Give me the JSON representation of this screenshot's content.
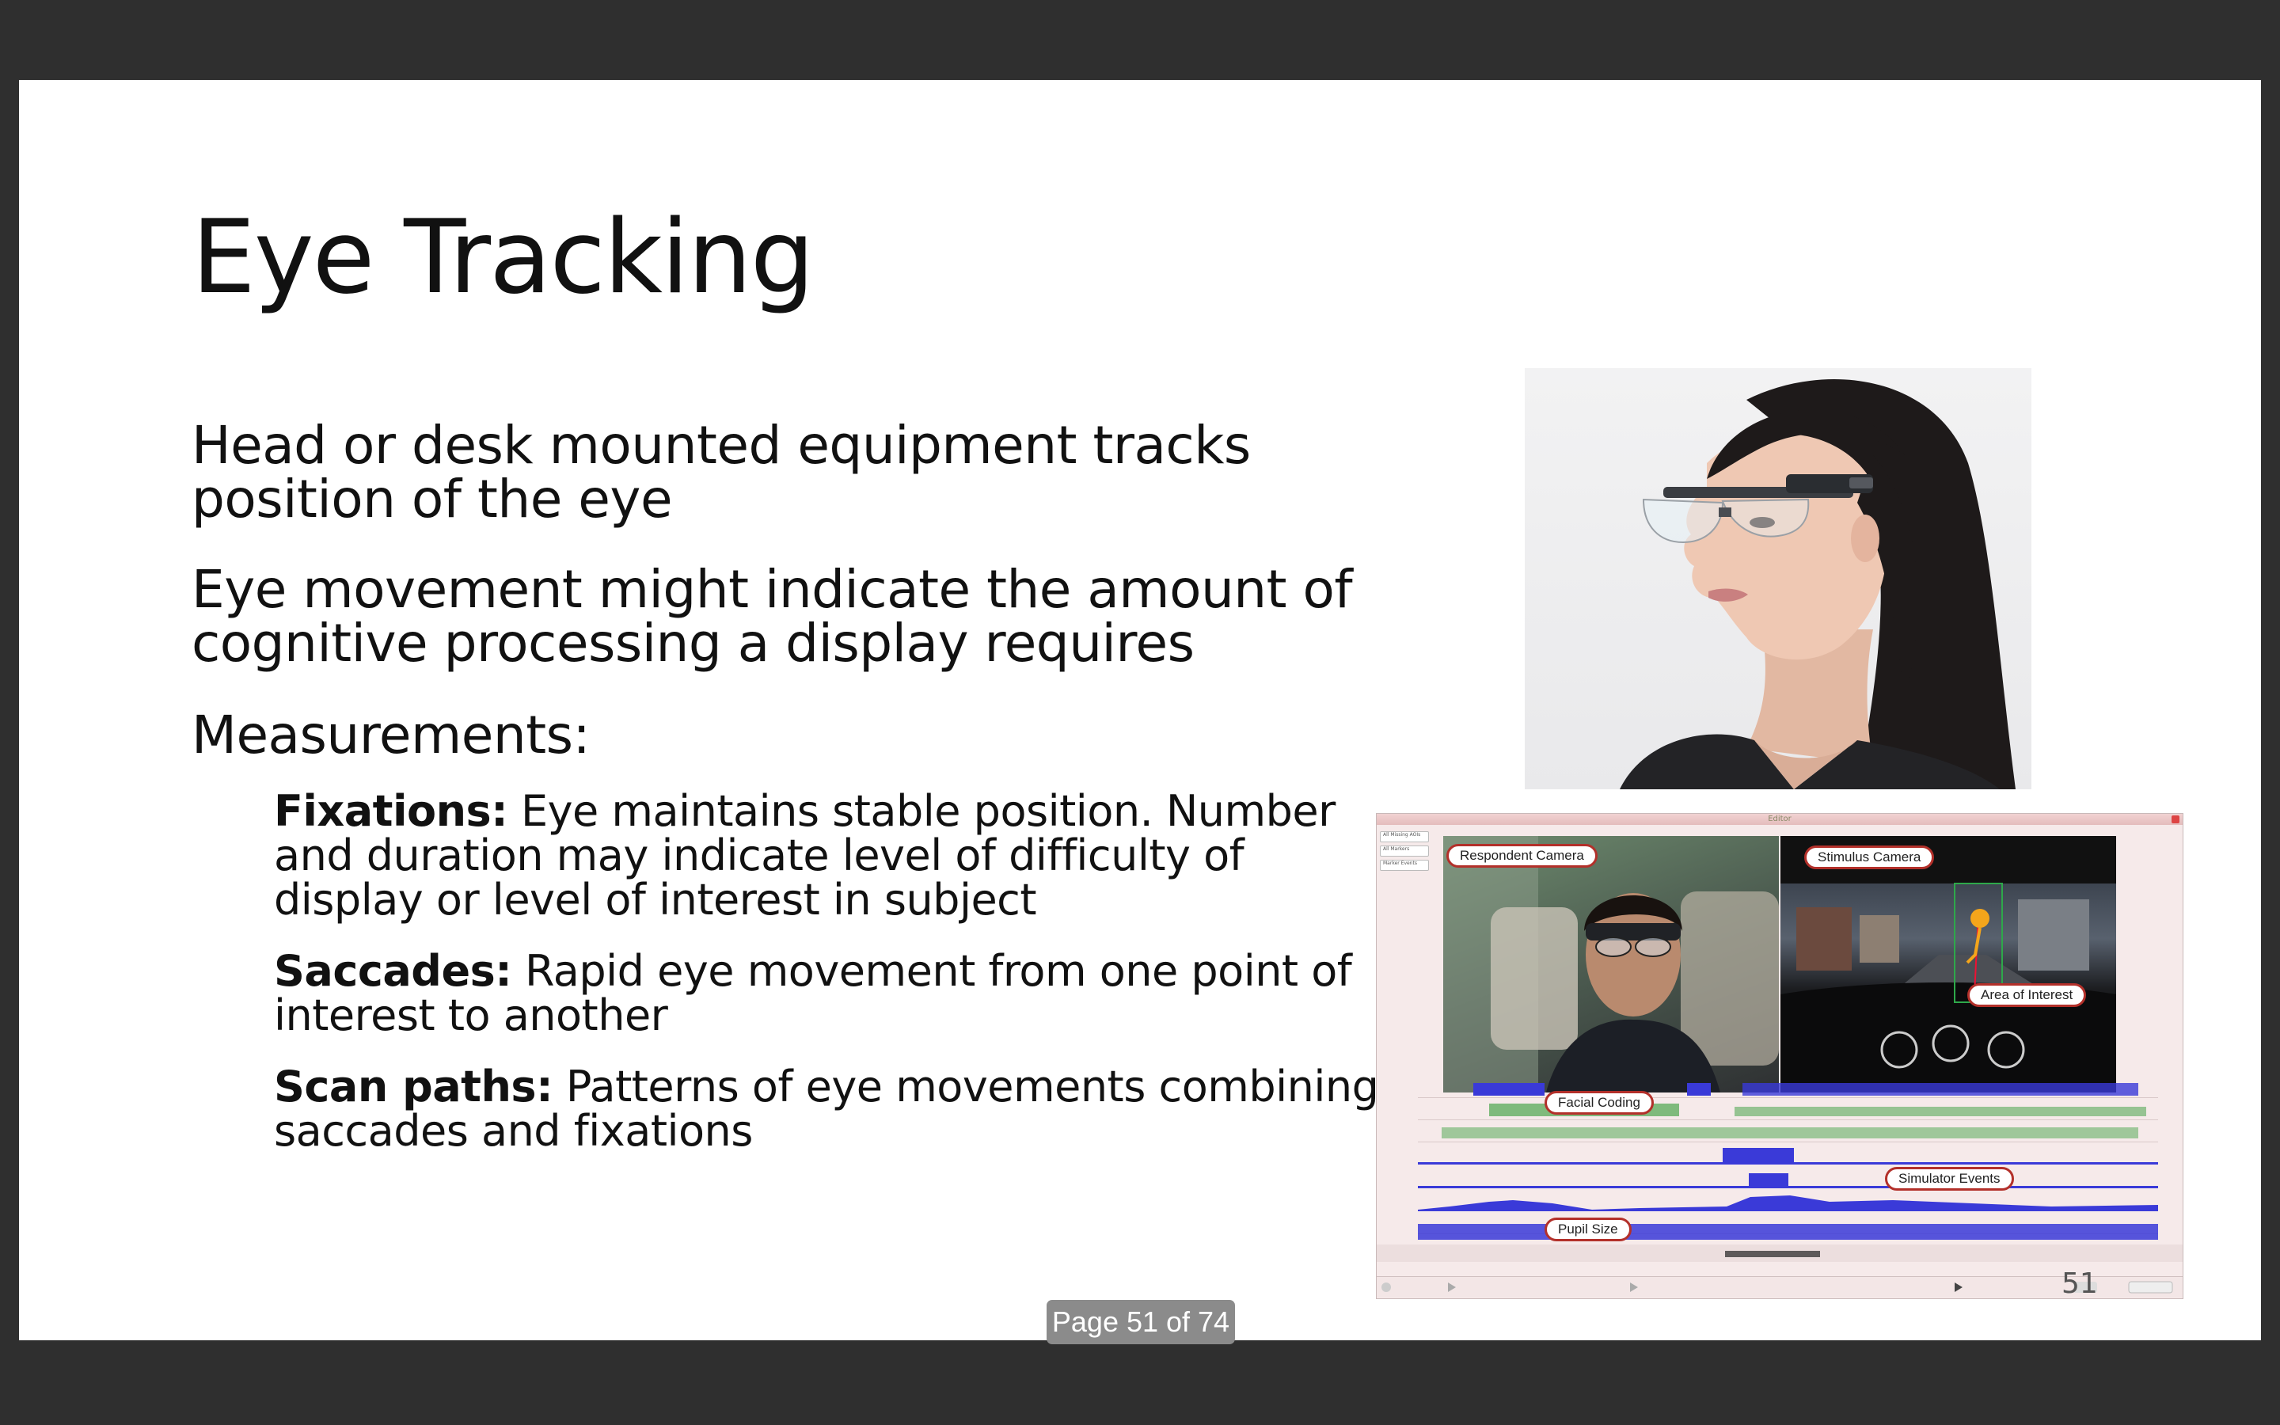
{
  "slide": {
    "title": "Eye Tracking",
    "bullets": [
      "Head or desk mounted equipment tracks position of the eye",
      "Eye movement might indicate the amount of cognitive processing a display requires",
      "Measurements:"
    ],
    "sub_bullets": [
      {
        "term": "Fixations:",
        "text": " Eye maintains stable position. Number and duration may indicate level of difficulty of display or level of interest in subject"
      },
      {
        "term": "Saccades:",
        "text": " Rapid eye movement from one point of interest to another"
      },
      {
        "term": "Scan paths:",
        "text": " Patterns of eye movements combining saccades and fixations"
      }
    ],
    "slide_number": "51"
  },
  "screenshot": {
    "window_title": "Editor",
    "side_buttons": [
      "All Missing AOIs",
      "All Markers",
      "Marker Events"
    ],
    "labels": {
      "respondent_camera": "Respondent Camera",
      "stimulus_camera": "Stimulus Camera",
      "area_of_interest": "Area of Interest",
      "facial_coding": "Facial Coding",
      "simulator_events": "Simulator Events",
      "pupil_size": "Pupil Size"
    }
  },
  "viewer": {
    "page_indicator": "Page 51 of 74"
  },
  "colors": {
    "background": "#2f2f2f",
    "slide": "#ffffff",
    "label_border": "#b3302a",
    "track_blue": "#3a3ad8",
    "track_green": "#57a957",
    "badge": "#8b8b8b"
  }
}
